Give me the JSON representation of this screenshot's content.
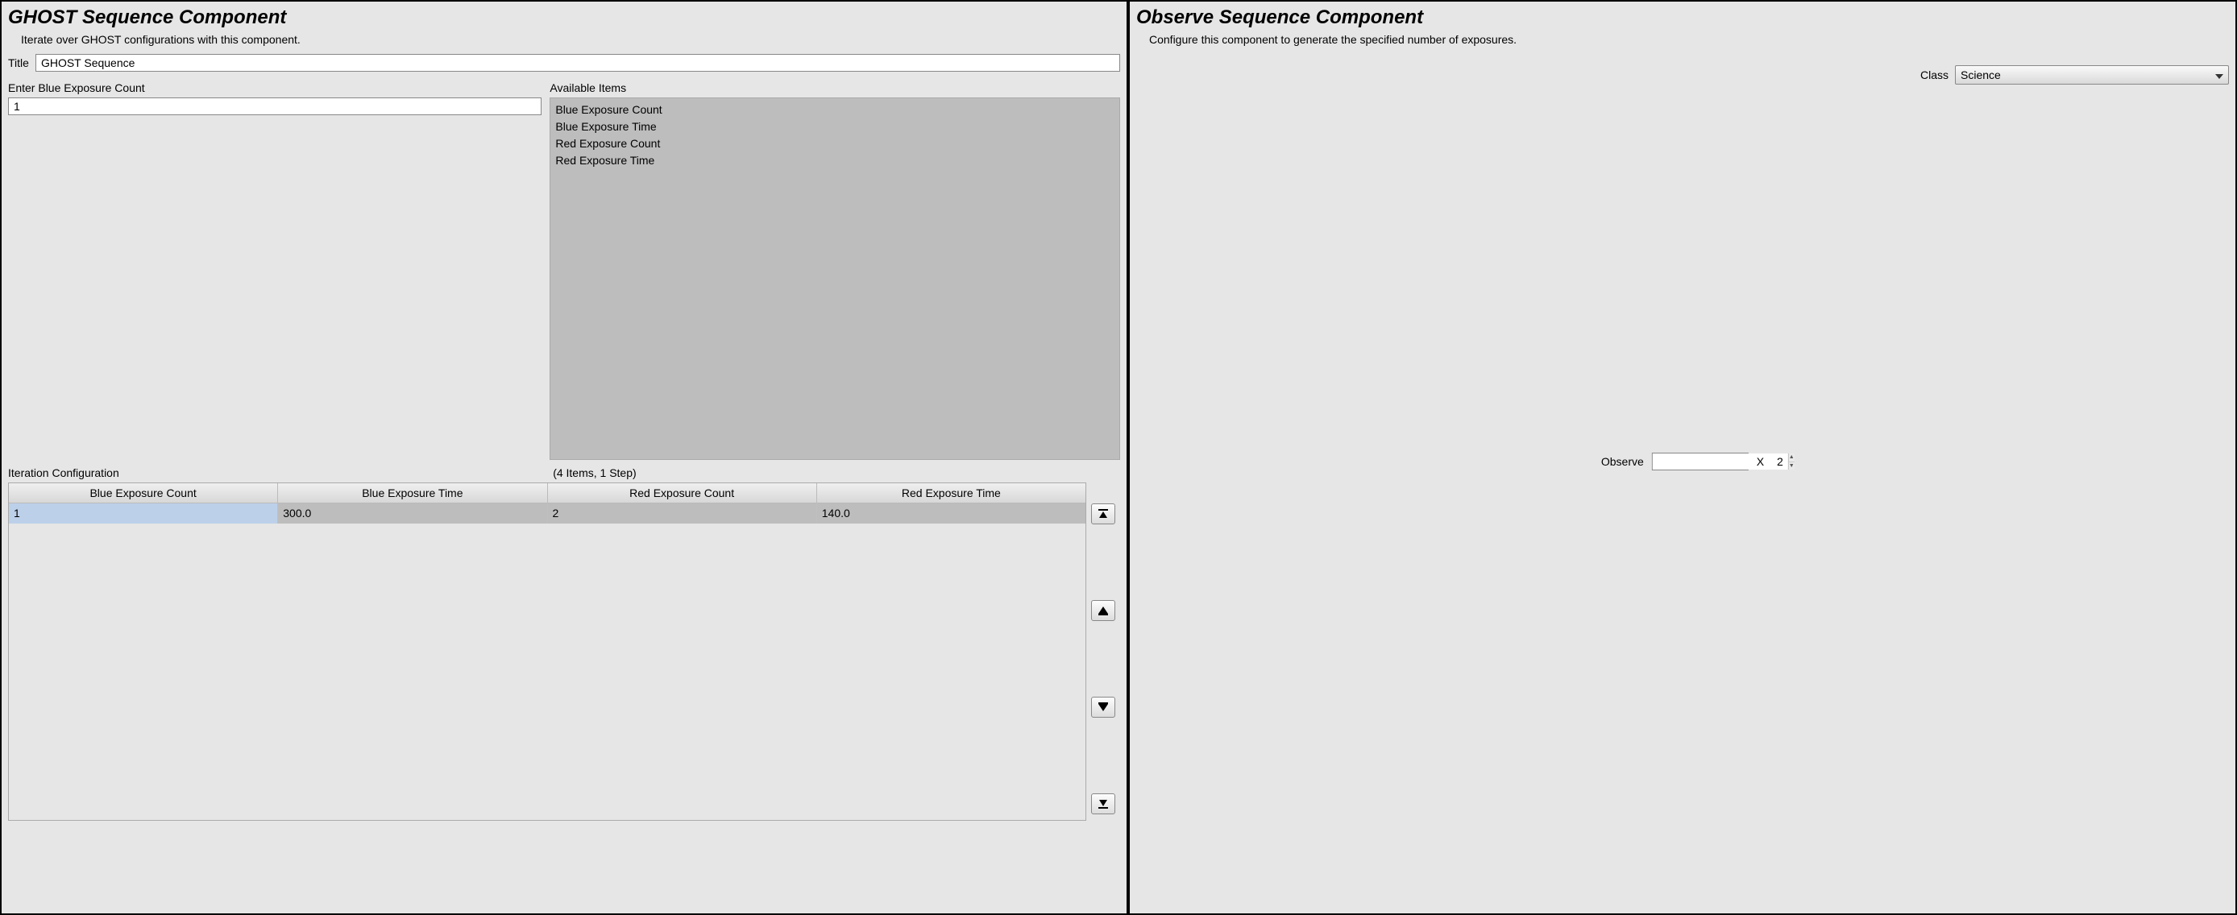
{
  "left": {
    "title": "GHOST Sequence Component",
    "subtitle": "Iterate over GHOST configurations with this component.",
    "title_label": "Title",
    "title_value": "GHOST Sequence",
    "count_label": "Enter Blue Exposure Count",
    "count_value": "1",
    "available_label": "Available Items",
    "available_items": [
      "Blue Exposure Count",
      "Blue Exposure Time",
      "Red Exposure Count",
      "Red Exposure Time"
    ],
    "config_label": "Iteration Configuration",
    "config_summary": "(4 Items, 1 Step)",
    "columns": [
      "Blue Exposure Count",
      "Blue Exposure Time",
      "Red Exposure Count",
      "Red Exposure Time"
    ],
    "rows": [
      {
        "blue_count": "1",
        "blue_time": "300.0",
        "red_count": "2",
        "red_time": "140.0"
      }
    ]
  },
  "right": {
    "title": "Observe Sequence Component",
    "subtitle": "Configure this component to generate the specified number of exposures.",
    "class_label": "Class",
    "class_value": "Science",
    "observe_label": "Observe",
    "observe_value": "2",
    "x_label": "X"
  }
}
